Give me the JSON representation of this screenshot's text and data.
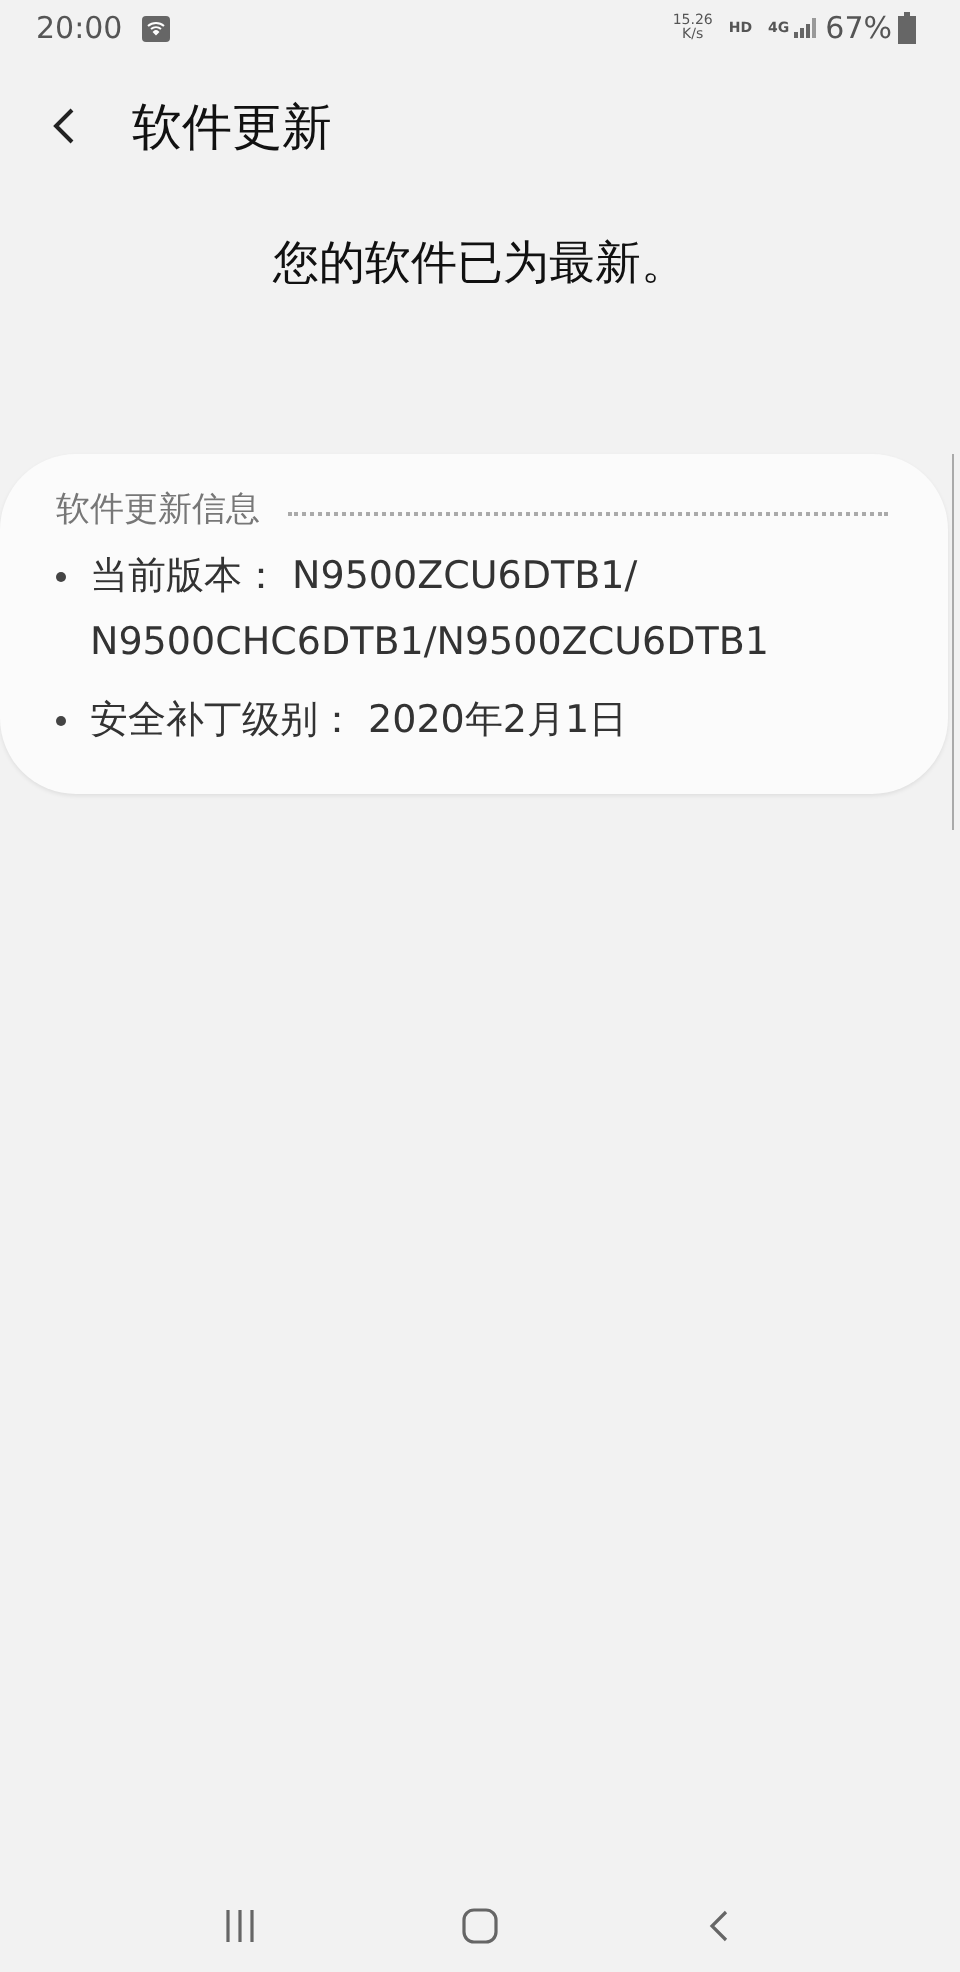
{
  "status_bar": {
    "time": "20:00",
    "net_speed": [
      "15.26",
      "K/s"
    ],
    "hd": "HD",
    "network": "4G",
    "battery": "67%"
  },
  "header": {
    "title": "软件更新"
  },
  "message": "您的软件已为最新。",
  "info_card": {
    "title": "软件更新信息",
    "items": [
      {
        "label": "当前版本：",
        "value": "N9500ZCU6DTB1/\nN9500CHC6DTB1/N9500ZCU6DTB1"
      },
      {
        "label": "安全补丁级别：",
        "value": "2020年2月1日"
      }
    ]
  }
}
